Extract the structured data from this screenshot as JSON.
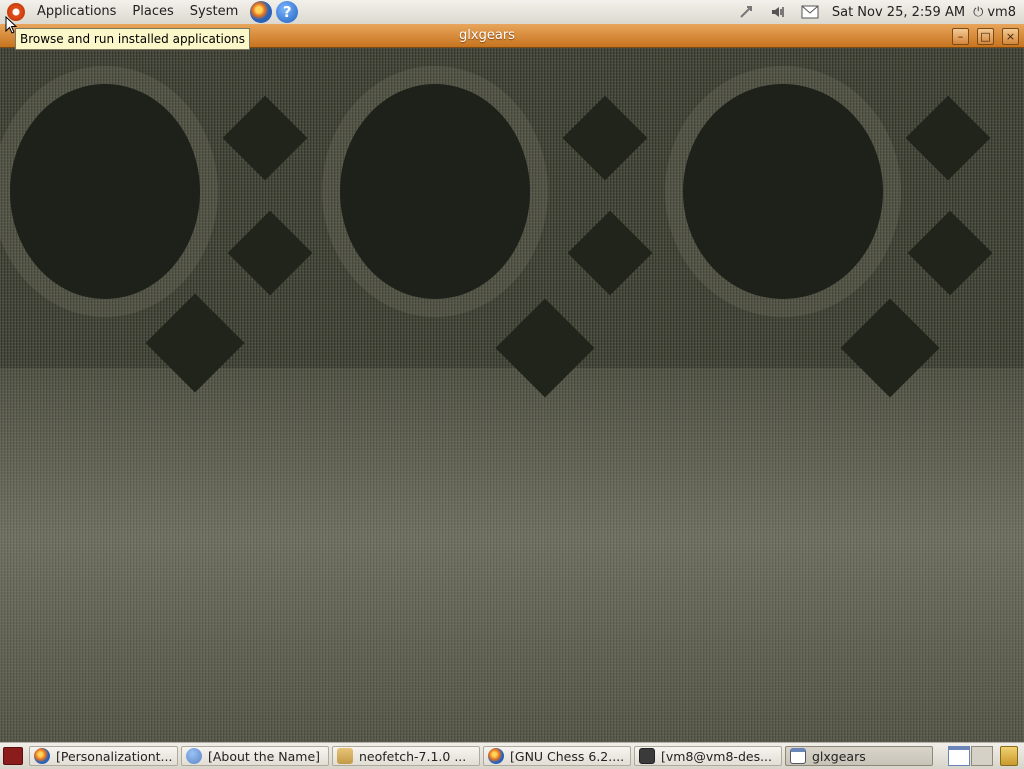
{
  "top_panel": {
    "menus": [
      "Applications",
      "Places",
      "System"
    ],
    "clock": "Sat Nov 25,  2:59 AM",
    "user": "vm8",
    "icons": [
      "ubuntu-logo-icon",
      "firefox-icon",
      "help-icon",
      "network-icon",
      "volume-icon",
      "mail-icon",
      "power-icon"
    ]
  },
  "tooltip": {
    "text": "Browse and run installed applications"
  },
  "window": {
    "title": "glxgears",
    "buttons": {
      "minimize": "–",
      "maximize": "□",
      "close": "×"
    }
  },
  "taskbar": {
    "tasks": [
      {
        "label": "[Personalizationt...",
        "icon": "firefox-icon"
      },
      {
        "label": "[About the Name]",
        "icon": "help-icon"
      },
      {
        "label": "neofetch-7.1.0 ...",
        "icon": "folder-icon"
      },
      {
        "label": "[GNU Chess 6.2....",
        "icon": "firefox-icon"
      },
      {
        "label": "[vm8@vm8-des...",
        "icon": "terminal-icon"
      },
      {
        "label": "glxgears",
        "icon": "window-icon",
        "active": true
      }
    ]
  }
}
